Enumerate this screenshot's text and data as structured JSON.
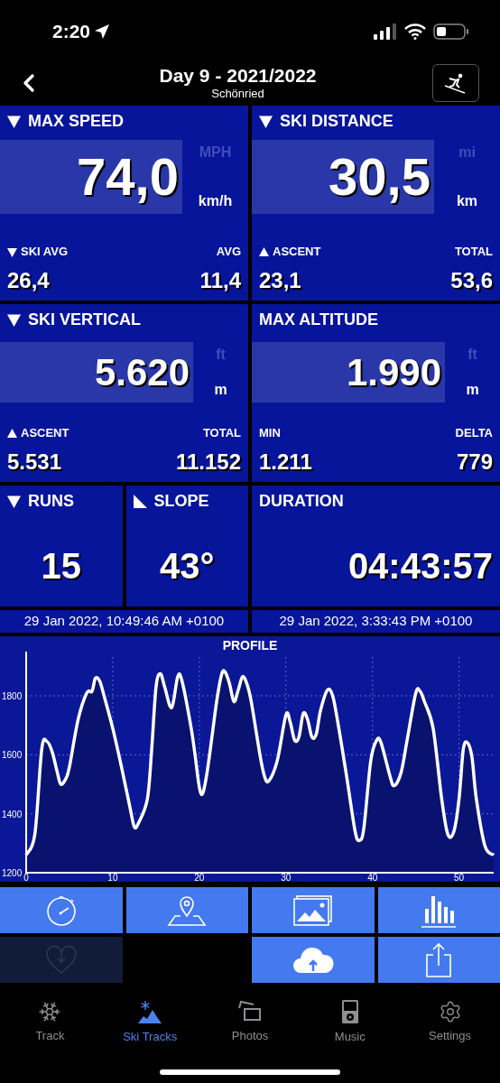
{
  "status_bar": {
    "time": "2:20"
  },
  "nav": {
    "title": "Day 9 - 2021/2022",
    "subtitle": "Schönried"
  },
  "stat_rows": [
    [
      {
        "title": "MAX SPEED",
        "kind": "down",
        "value": "74,0",
        "units": [
          {
            "label": "MPH",
            "selected": false
          },
          {
            "label": "km/h",
            "selected": true
          }
        ],
        "sub": [
          {
            "label": "SKI AVG",
            "kind": "down",
            "value": "26,4"
          },
          {
            "label": "AVG",
            "value": "11,4"
          }
        ]
      },
      {
        "title": "SKI DISTANCE",
        "kind": "down",
        "value": "30,5",
        "units": [
          {
            "label": "mi",
            "selected": false
          },
          {
            "label": "km",
            "selected": true
          }
        ],
        "sub": [
          {
            "label": "ASCENT",
            "kind": "up",
            "value": "23,1"
          },
          {
            "label": "TOTAL",
            "value": "53,6"
          }
        ]
      }
    ],
    [
      {
        "title": "SKI VERTICAL",
        "kind": "down",
        "value": "5.620",
        "units": [
          {
            "label": "ft",
            "selected": false
          },
          {
            "label": "m",
            "selected": true
          }
        ],
        "sub": [
          {
            "label": "ASCENT",
            "kind": "up",
            "value": "5.531"
          },
          {
            "label": "TOTAL",
            "value": "11.152"
          }
        ]
      },
      {
        "title": "MAX ALTITUDE",
        "value": "1.990",
        "units": [
          {
            "label": "ft",
            "selected": false
          },
          {
            "label": "m",
            "selected": true
          }
        ],
        "sub": [
          {
            "label": "MIN",
            "value": "1.211"
          },
          {
            "label": "DELTA",
            "value": "779"
          }
        ]
      }
    ]
  ],
  "small_tiles": [
    {
      "title": "RUNS",
      "kind": "down",
      "value": "15"
    },
    {
      "title": "SLOPE",
      "kind": "slope",
      "value": "43°"
    },
    {
      "title": "DURATION",
      "value": "04:43:57"
    }
  ],
  "times": {
    "start": "29 Jan 2022, 10:49:46 AM +0100",
    "end": "29 Jan 2022, 3:33:43 PM +0100"
  },
  "profile": {
    "chart_data": {
      "type": "area",
      "title": "PROFILE",
      "grid": true,
      "xlim": [
        0,
        54
      ],
      "ylim": [
        1200,
        1950
      ],
      "xticks": [
        0,
        10,
        20,
        30,
        40,
        50
      ],
      "yticks": [
        1200,
        1400,
        1600,
        1800
      ],
      "x": [
        0,
        1,
        1.8,
        2.4,
        3,
        3.6,
        4,
        4.6,
        5,
        6,
        7,
        7.6,
        8,
        8.5,
        9,
        10,
        11,
        12,
        12.5,
        13,
        14,
        14.5,
        15,
        15.5,
        16,
        16.8,
        17.5,
        18,
        19,
        19.5,
        20,
        20.4,
        21,
        22,
        22.6,
        23,
        23.5,
        24,
        24.5,
        25,
        25.5,
        26,
        27,
        27.5,
        28,
        29,
        30,
        30.5,
        31,
        31.5,
        32,
        32.5,
        33,
        33.5,
        34,
        34.8,
        35.4,
        36,
        37,
        38,
        38.5,
        39,
        39.8,
        40.5,
        41,
        42,
        42.5,
        43.3,
        44,
        45,
        45.5,
        46,
        47,
        48,
        48.7,
        49.4,
        50,
        50.5,
        51,
        51.5,
        52,
        53,
        54
      ],
      "series": [
        {
          "color": "#ffffff",
          "values": [
            1260,
            1330,
            1620,
            1645,
            1610,
            1540,
            1500,
            1520,
            1560,
            1720,
            1810,
            1815,
            1860,
            1850,
            1800,
            1690,
            1560,
            1420,
            1355,
            1370,
            1450,
            1620,
            1830,
            1875,
            1830,
            1760,
            1865,
            1850,
            1700,
            1600,
            1490,
            1470,
            1560,
            1780,
            1875,
            1880,
            1840,
            1780,
            1820,
            1865,
            1840,
            1780,
            1600,
            1530,
            1510,
            1580,
            1735,
            1710,
            1650,
            1660,
            1740,
            1720,
            1660,
            1670,
            1750,
            1820,
            1800,
            1710,
            1530,
            1340,
            1310,
            1350,
            1580,
            1650,
            1640,
            1530,
            1495,
            1540,
            1650,
            1810,
            1815,
            1780,
            1690,
            1450,
            1330,
            1340,
            1450,
            1620,
            1640,
            1590,
            1450,
            1290,
            1260
          ]
        }
      ]
    }
  },
  "action_rows": [
    [
      {
        "kind": "stopwatch",
        "disabled": false
      },
      {
        "kind": "map-pin",
        "disabled": false
      },
      {
        "kind": "photos",
        "disabled": false
      },
      {
        "kind": "bars",
        "disabled": false
      }
    ],
    [
      {
        "kind": "heart",
        "disabled": true
      },
      {
        "kind": "blank"
      },
      {
        "kind": "cloud-upload",
        "disabled": false
      },
      {
        "kind": "share",
        "disabled": false
      }
    ]
  ],
  "tab_bar": [
    {
      "label": "Track",
      "kind": "snowflake",
      "selected": false
    },
    {
      "label": "Ski Tracks",
      "kind": "mountain",
      "selected": true
    },
    {
      "label": "Photos",
      "kind": "photos",
      "selected": false
    },
    {
      "label": "Music",
      "kind": "player",
      "selected": false
    },
    {
      "label": "Settings",
      "kind": "gear",
      "selected": false
    }
  ]
}
